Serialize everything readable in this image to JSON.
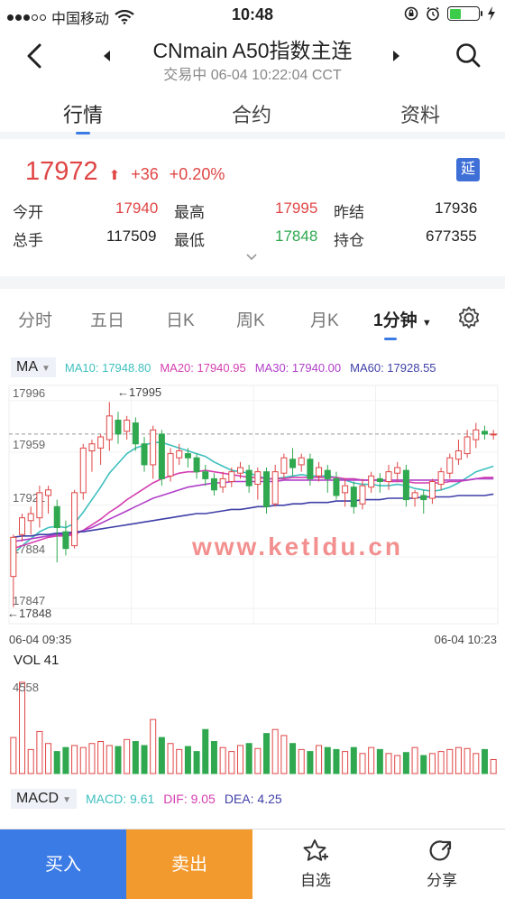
{
  "status": {
    "carrier": "中国移动",
    "time": "10:48"
  },
  "header": {
    "title": "CNmain A50指数主连",
    "subtitle": "交易中 06-04 10:22:04 CCT"
  },
  "main_tabs": [
    {
      "label": "行情",
      "active": true
    },
    {
      "label": "合约",
      "active": false
    },
    {
      "label": "资料",
      "active": false
    }
  ],
  "quote": {
    "price": "17972",
    "change": "+36",
    "change_pct": "+0.20%",
    "badge": "延",
    "rows": [
      {
        "l1": "今开",
        "v1": "17940",
        "l2": "最高",
        "v2": "17995",
        "l3": "昨结",
        "v3": "17936"
      },
      {
        "l1": "总手",
        "v1": "117509",
        "l2": "最低",
        "v2": "17848",
        "l3": "持仓",
        "v3": "677355"
      }
    ]
  },
  "period_tabs": [
    {
      "label": "分时"
    },
    {
      "label": "五日"
    },
    {
      "label": "日K"
    },
    {
      "label": "周K"
    },
    {
      "label": "月K"
    },
    {
      "label": "1分钟",
      "active": true
    }
  ],
  "ma": {
    "select": "MA",
    "values": [
      {
        "text": "MA10: 17948.80",
        "color": "#3fbfbf"
      },
      {
        "text": "MA20: 17940.95",
        "color": "#d43fb0"
      },
      {
        "text": "MA30: 17940.00",
        "color": "#b03fc8"
      },
      {
        "text": "MA60: 17928.55",
        "color": "#3f3fa8"
      }
    ]
  },
  "chart_data": {
    "type": "candlestick",
    "y_ticks": [
      "17996",
      "17959",
      "17921",
      "17884",
      "17847"
    ],
    "ylim": [
      17840,
      18003
    ],
    "max_label": "←17995",
    "min_label": "←17848",
    "x_start": "06-04 09:35",
    "x_end": "06-04 10:23",
    "last_price": 17972,
    "watermark": "www.ketldu.cn",
    "candles": [
      [
        17870,
        17898,
        17848,
        17900
      ],
      [
        17900,
        17912,
        17895,
        17915
      ],
      [
        17910,
        17915,
        17900,
        17920
      ],
      [
        17912,
        17930,
        17905,
        17935
      ],
      [
        17928,
        17932,
        17915,
        17935
      ],
      [
        17920,
        17905,
        17880,
        17925
      ],
      [
        17902,
        17890,
        17885,
        17910
      ],
      [
        17892,
        17930,
        17890,
        17932
      ],
      [
        17930,
        17962,
        17925,
        17965
      ],
      [
        17960,
        17965,
        17945,
        17968
      ],
      [
        17962,
        17970,
        17950,
        17972
      ],
      [
        17968,
        17985,
        17960,
        17995
      ],
      [
        17982,
        17972,
        17965,
        17988
      ],
      [
        17974,
        17982,
        17968,
        17985
      ],
      [
        17980,
        17965,
        17960,
        17984
      ],
      [
        17965,
        17950,
        17945,
        17970
      ],
      [
        17950,
        17975,
        17940,
        17978
      ],
      [
        17972,
        17940,
        17935,
        17975
      ],
      [
        17942,
        17958,
        17938,
        17962
      ],
      [
        17955,
        17960,
        17950,
        17965
      ],
      [
        17958,
        17955,
        17948,
        17962
      ],
      [
        17955,
        17945,
        17940,
        17958
      ],
      [
        17945,
        17940,
        17935,
        17950
      ],
      [
        17940,
        17932,
        17928,
        17944
      ],
      [
        17934,
        17940,
        17930,
        17945
      ],
      [
        17938,
        17945,
        17934,
        17948
      ],
      [
        17944,
        17948,
        17940,
        17952
      ],
      [
        17946,
        17935,
        17930,
        17950
      ],
      [
        17936,
        17945,
        17925,
        17948
      ],
      [
        17945,
        17920,
        17915,
        17948
      ],
      [
        17922,
        17945,
        17920,
        17950
      ],
      [
        17944,
        17955,
        17940,
        17958
      ],
      [
        17954,
        17948,
        17942,
        17962
      ],
      [
        17950,
        17955,
        17945,
        17958
      ],
      [
        17954,
        17940,
        17935,
        17958
      ],
      [
        17942,
        17948,
        17938,
        17952
      ],
      [
        17946,
        17940,
        17930,
        17950
      ],
      [
        17940,
        17928,
        17925,
        17945
      ],
      [
        17930,
        17935,
        17920,
        17940
      ],
      [
        17934,
        17920,
        17915,
        17938
      ],
      [
        17922,
        17935,
        17918,
        17940
      ],
      [
        17934,
        17942,
        17930,
        17945
      ],
      [
        17940,
        17938,
        17930,
        17944
      ],
      [
        17938,
        17945,
        17932,
        17950
      ],
      [
        17944,
        17948,
        17938,
        17952
      ],
      [
        17946,
        17925,
        17920,
        17950
      ],
      [
        17926,
        17930,
        17920,
        17932
      ],
      [
        17928,
        17925,
        17915,
        17932
      ],
      [
        17926,
        17938,
        17922,
        17940
      ],
      [
        17936,
        17945,
        17932,
        17948
      ],
      [
        17944,
        17955,
        17940,
        17958
      ],
      [
        17954,
        17960,
        17950,
        17968
      ],
      [
        17958,
        17970,
        17955,
        17975
      ],
      [
        17968,
        17975,
        17962,
        17980
      ],
      [
        17974,
        17972,
        17968,
        17978
      ],
      [
        17972,
        17972,
        17968,
        17975
      ]
    ],
    "ma_lines": [
      {
        "name": "MA10",
        "color": "#3fbfbf",
        "values": [
          17886,
          17892,
          17897,
          17902,
          17905,
          17906,
          17905,
          17908,
          17916,
          17925,
          17934,
          17944,
          17951,
          17958,
          17962,
          17964,
          17966,
          17966,
          17964,
          17962,
          17960,
          17958,
          17956,
          17952,
          17949,
          17946,
          17945,
          17944,
          17942,
          17940,
          17940,
          17941,
          17942,
          17943,
          17942,
          17942,
          17942,
          17941,
          17939,
          17937,
          17936,
          17936,
          17935,
          17935,
          17936,
          17935,
          17933,
          17932,
          17931,
          17932,
          17934,
          17937,
          17941,
          17945,
          17947,
          17949
        ]
      },
      {
        "name": "MA20",
        "color": "#d43fb0",
        "values": [
          17890,
          17892,
          17894,
          17896,
          17898,
          17899,
          17899,
          17900,
          17903,
          17907,
          17911,
          17916,
          17920,
          17925,
          17929,
          17933,
          17937,
          17940,
          17942,
          17944,
          17945,
          17945,
          17946,
          17945,
          17944,
          17943,
          17942,
          17941,
          17941,
          17940,
          17940,
          17940,
          17941,
          17941,
          17941,
          17941,
          17941,
          17941,
          17940,
          17940,
          17939,
          17939,
          17939,
          17938,
          17938,
          17938,
          17937,
          17937,
          17937,
          17937,
          17938,
          17938,
          17939,
          17940,
          17941,
          17941
        ]
      },
      {
        "name": "MA30",
        "color": "#b03fc8",
        "values": [
          17895,
          17896,
          17897,
          17898,
          17899,
          17900,
          17900,
          17901,
          17903,
          17905,
          17908,
          17911,
          17914,
          17917,
          17920,
          17923,
          17926,
          17928,
          17930,
          17932,
          17934,
          17935,
          17936,
          17937,
          17937,
          17938,
          17938,
          17938,
          17938,
          17938,
          17938,
          17939,
          17939,
          17939,
          17939,
          17939,
          17939,
          17939,
          17939,
          17939,
          17939,
          17939,
          17939,
          17939,
          17939,
          17939,
          17939,
          17939,
          17939,
          17939,
          17939,
          17939,
          17939,
          17940,
          17940,
          17940
        ]
      },
      {
        "name": "MA60",
        "color": "#3f3fa8",
        "values": [
          17898,
          17899,
          17899,
          17900,
          17900,
          17901,
          17901,
          17902,
          17902,
          17903,
          17904,
          17905,
          17906,
          17907,
          17908,
          17909,
          17910,
          17911,
          17912,
          17913,
          17914,
          17915,
          17915,
          17916,
          17917,
          17918,
          17918,
          17919,
          17920,
          17920,
          17921,
          17921,
          17922,
          17922,
          17923,
          17923,
          17923,
          17924,
          17924,
          17924,
          17925,
          17925,
          17925,
          17926,
          17926,
          17926,
          17926,
          17927,
          17927,
          17927,
          17927,
          17928,
          17928,
          17928,
          17928,
          17929
        ]
      }
    ],
    "vol_label": "VOL 41",
    "vol_max_label": "4558",
    "vol_max": 4600,
    "volumes": [
      1800,
      4558,
      1200,
      2100,
      1500,
      1100,
      1300,
      1400,
      1300,
      1500,
      1600,
      1400,
      1350,
      1700,
      1600,
      1400,
      2700,
      1800,
      1500,
      1200,
      1350,
      1100,
      2200,
      1600,
      1300,
      1100,
      1400,
      1500,
      1250,
      2000,
      2200,
      1900,
      1500,
      1200,
      1100,
      1400,
      1300,
      1200,
      1100,
      1300,
      1000,
      1300,
      1200,
      1000,
      900,
      1050,
      1300,
      900,
      1000,
      1100,
      1200,
      1300,
      1250,
      1000,
      1200,
      700
    ]
  },
  "macd": {
    "select": "MACD",
    "macd": "MACD: 9.61",
    "dif": "DIF: 9.05",
    "dea": "DEA: 4.25"
  },
  "bottom": {
    "buy": "买入",
    "sell": "卖出",
    "watch": "自选",
    "share": "分享"
  }
}
